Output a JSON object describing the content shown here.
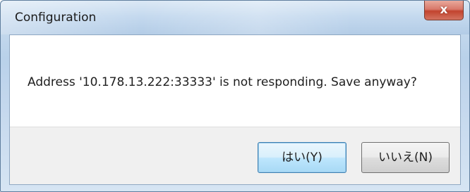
{
  "window": {
    "title": "Configuration",
    "close_glyph": "x"
  },
  "dialog": {
    "message": "Address '10.178.13.222:33333' is not responding. Save anyway?"
  },
  "buttons": {
    "yes_label": "はい(Y)",
    "no_label": "いいえ(N)"
  },
  "colors": {
    "titlebar": "#c3d8ee",
    "close_button": "#c2442e",
    "default_button_border": "#3c7fb1",
    "button_bar": "#f0f0f0"
  }
}
